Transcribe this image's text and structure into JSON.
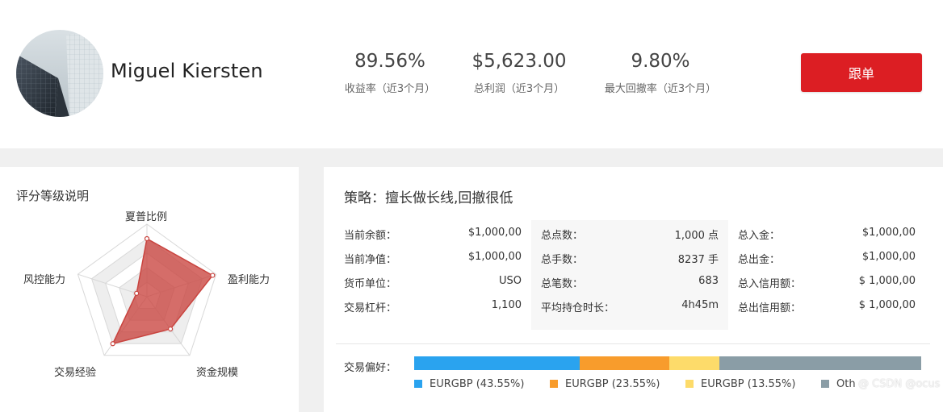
{
  "profile": {
    "name": "Miguel Kiersten",
    "avatar": "building-photo-avatar"
  },
  "stats": [
    {
      "value": "89.56%",
      "label": "收益率（近3个月）"
    },
    {
      "value": "$5,623.00",
      "label": "总利润（近3个月）"
    },
    {
      "value": "9.80%",
      "label": "最大回撤率（近3个月）"
    }
  ],
  "follow_button": "跟单",
  "rating": {
    "title": "评分等级说明",
    "axes": [
      "夏普比例",
      "盈利能力",
      "资金规模",
      "交易经验",
      "风控能力"
    ],
    "radar_values": [
      0.8,
      0.95,
      0.55,
      0.8,
      0.15
    ],
    "radar_color": "#c9443f"
  },
  "strategy": "策略：擅长做长线,回撤很低",
  "account": {
    "col1": [
      {
        "k": "当前余额：",
        "v": "$1,000,00"
      },
      {
        "k": "当前净值：",
        "v": "$1,000,00"
      },
      {
        "k": "货币单位：",
        "v": "USO"
      },
      {
        "k": "交易杠杆：",
        "v": "1,100"
      }
    ],
    "col2": [
      {
        "k": "总点数：",
        "v": "1,000 点"
      },
      {
        "k": "总手数：",
        "v": "8237 手"
      },
      {
        "k": "总笔数：",
        "v": "683"
      },
      {
        "k": "平均持仓时长：",
        "v": "4h45m"
      }
    ],
    "col3": [
      {
        "k": "总入金：",
        "v": "$1,000,00"
      },
      {
        "k": "总出金：",
        "v": "$1,000,00"
      },
      {
        "k": "总入信用额：",
        "v": "$ 1,000,00"
      },
      {
        "k": "总出信用额：",
        "v": "$ 1,000,00"
      }
    ]
  },
  "preference": {
    "label": "交易偏好：",
    "segments": [
      {
        "name": "EURGBP (43.55%)",
        "share": 0.3265,
        "color": "#2aa3ef"
      },
      {
        "name": "EURGBP (23.55%)",
        "share": 0.1765,
        "color": "#f89c2c"
      },
      {
        "name": "EURGBP (13.55%)",
        "share": 0.0985,
        "color": "#fddb6a"
      },
      {
        "name": "Oth",
        "share": 0.3985,
        "color": "#8a9da6"
      }
    ]
  },
  "watermark": "@ CSDN @ocus"
}
